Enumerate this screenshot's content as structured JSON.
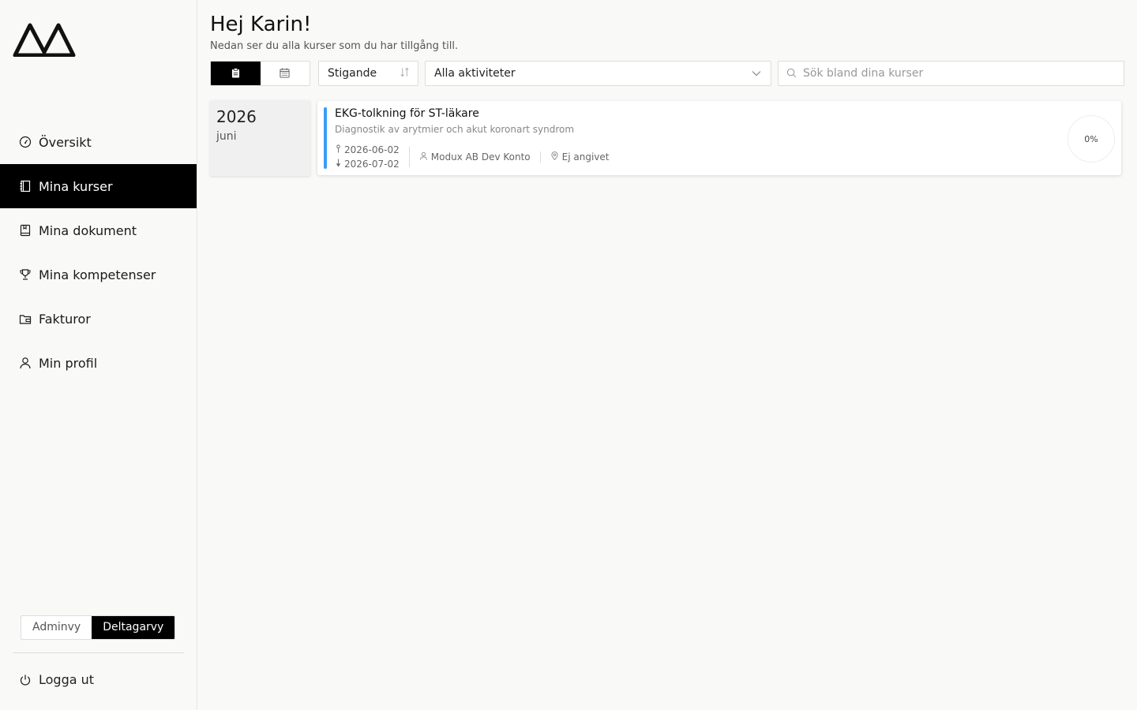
{
  "sidebar": {
    "nav": [
      {
        "label": "Översikt",
        "icon": "gauge-icon",
        "active": false
      },
      {
        "label": "Mina kurser",
        "icon": "notebook-icon",
        "active": true
      },
      {
        "label": "Mina dokument",
        "icon": "book-icon",
        "active": false
      },
      {
        "label": "Mina kompetenser",
        "icon": "trophy-icon",
        "active": false
      },
      {
        "label": "Fakturor",
        "icon": "wallet-icon",
        "active": false
      },
      {
        "label": "Min profil",
        "icon": "user-icon",
        "active": false
      }
    ],
    "view_toggle": {
      "admin_label": "Adminvy",
      "participant_label": "Deltagarvy",
      "selected": "Deltagarvy"
    },
    "logout_label": "Logga ut"
  },
  "header": {
    "greeting": "Hej Karin!",
    "subtitle": "Nedan ser du alla kurser som du har tillgång till."
  },
  "toolbar": {
    "selected_mode": "list",
    "sort_value": "Stigande",
    "activity_value": "Alla aktiviteter",
    "search_placeholder": "Sök bland dina kurser"
  },
  "groups": [
    {
      "year": "2026",
      "month": "juni",
      "courses": [
        {
          "title": "EKG-tolkning för ST-läkare",
          "description": "Diagnostik av arytmier och akut koronart syndrom",
          "start_date": "2026-06-02",
          "end_date": "2026-07-02",
          "organizer": "Modux AB Dev Konto",
          "location": "Ej angivet",
          "progress": "0%",
          "accent_color": "#3b9cf5"
        }
      ]
    }
  ],
  "colors": {
    "active_bg": "#000000",
    "accent": "#3b9cf5",
    "background": "#f9f9f8"
  }
}
